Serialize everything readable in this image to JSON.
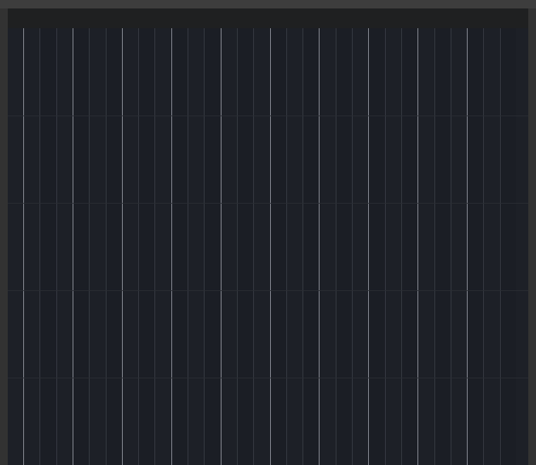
{
  "window": {
    "title": ""
  },
  "grid": {
    "column_count": 30,
    "row_count": 5,
    "colors": {
      "frame": "#323232",
      "panel": "#1e1f22",
      "grid_bg": "#1d2027",
      "bright_line": "#cfd3dc",
      "dim_line": "#4a4e58",
      "row_line": "#2a2d33"
    }
  }
}
